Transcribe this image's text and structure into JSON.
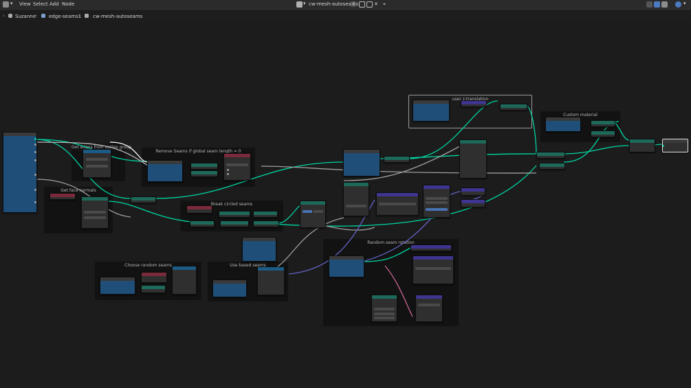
{
  "topbar": {
    "menus": [
      "View",
      "Select",
      "Add",
      "Node"
    ],
    "tree_name": "cw-mesh-autoseams",
    "user_count": "4"
  },
  "breadcrumb": {
    "items": [
      "Suzanne",
      "edge-seams1",
      "cw-mesh-autoseams"
    ]
  },
  "frames": {
    "user_z": "user z-translation",
    "custom_material": "Custom material",
    "edges_from_group": "Get edges from vertex group",
    "remove_seams": "Remove Seams if global seam length = 0",
    "get_face_normals": "Get face normals",
    "break_circled": "Break circled seams",
    "random_rotation": "Random seam rotation",
    "choose_random": "Choose random seams",
    "use_based": "Use based seams"
  },
  "colors": {
    "geometry_wire": "#00d6a3",
    "float_wire": "#a1a1a1",
    "vector_wire": "#6363c7",
    "group_node_body": "#1f4e79",
    "frame_bg": "#121212",
    "editor_bg": "#1c1c1c"
  },
  "icons": [
    "editor-type-icon",
    "node-tree-icon",
    "shield-icon",
    "copy-icon",
    "close-icon",
    "pin-icon",
    "object-icon",
    "modifier-icon",
    "node-group-icon",
    "overlay-icon",
    "view-icon"
  ]
}
